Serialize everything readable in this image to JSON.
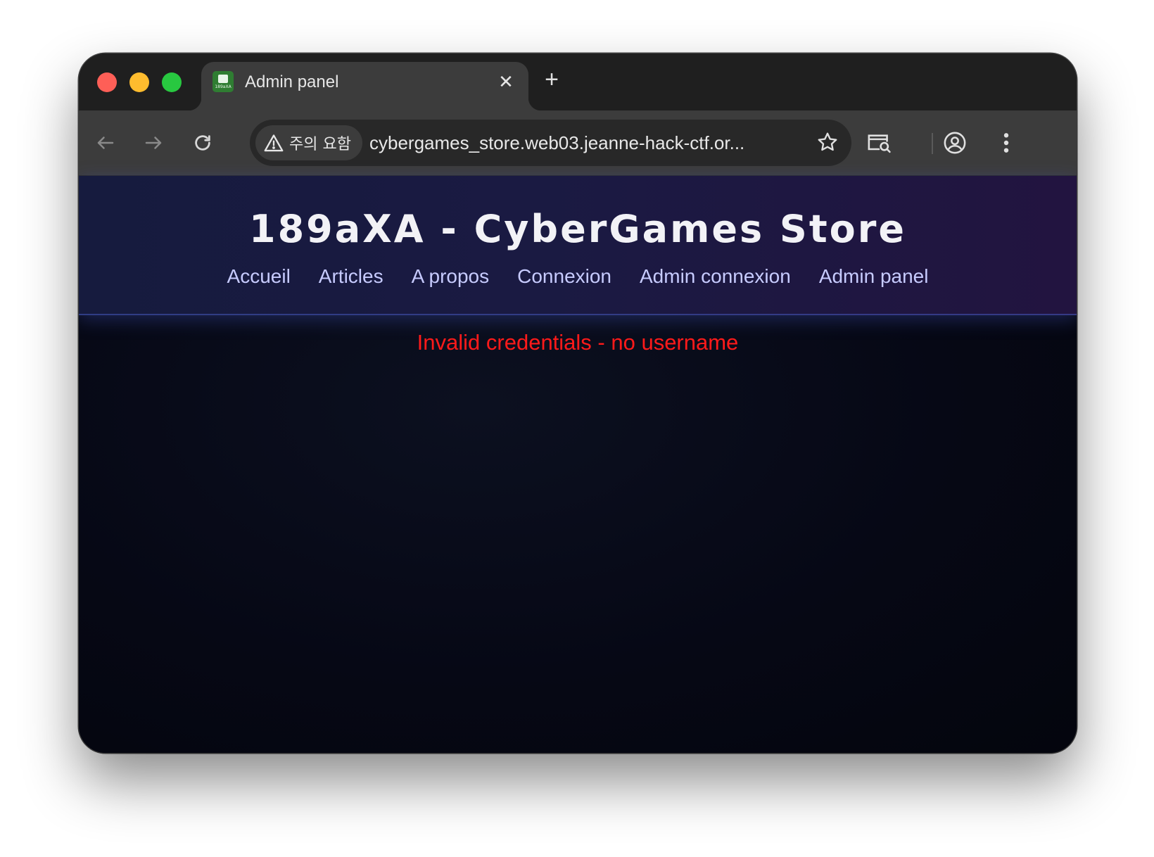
{
  "browser": {
    "tab": {
      "title": "Admin panel",
      "favicon_text": "189aXA",
      "close_glyph": "✕"
    },
    "new_tab_glyph": "+",
    "security_chip_label": "주의 요함",
    "url": "cybergames_store.web03.jeanne-hack-ctf.or...",
    "traffic_lights": {
      "close": "#fe5f57",
      "minimize": "#febc2e",
      "maximize": "#28c840"
    }
  },
  "site": {
    "title": "189aXA - CyberGames Store",
    "nav": [
      {
        "label": "Accueil"
      },
      {
        "label": "Articles"
      },
      {
        "label": "A propos"
      },
      {
        "label": "Connexion"
      },
      {
        "label": "Admin connexion"
      },
      {
        "label": "Admin panel"
      }
    ],
    "error_message": "Invalid credentials - no username",
    "colors": {
      "error": "#ff1a1a",
      "nav_link": "#c7cbff",
      "header_bg": "#1a1a42"
    }
  }
}
